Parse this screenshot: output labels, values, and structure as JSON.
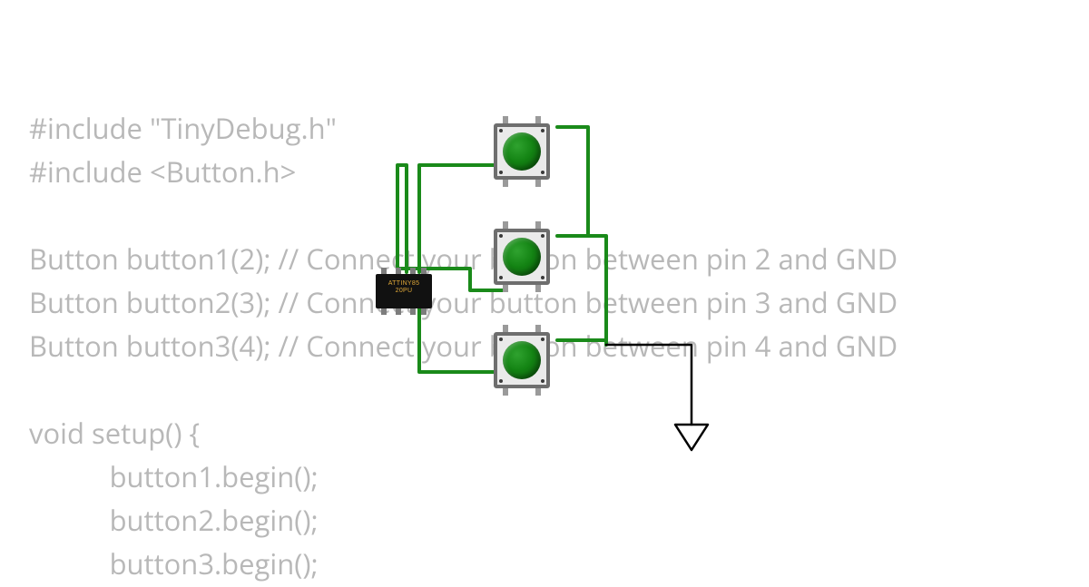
{
  "code": {
    "lines": [
      "#include \"TinyDebug.h\"",
      "#include <Button.h>",
      "",
      "Button button1(2); // Connect your button between pin 2 and GND",
      "Button button2(3); // Connect your button between pin 3 and GND",
      "Button button3(4); // Connect your button between pin 4 and GND",
      "",
      "void setup() {",
      "           button1.begin();",
      "           button2.begin();",
      "           button3.begin();"
    ]
  },
  "chip": {
    "label_line1": "ATTINY85",
    "label_line2": "20PU"
  },
  "components": {
    "buttons": [
      "button1",
      "button2",
      "button3"
    ],
    "ic": "ATtiny85"
  },
  "colors": {
    "wire_signal": "#1a8a1a",
    "wire_gnd": "#000000",
    "code_text": "#b8b8b8",
    "button_cap": "#148414"
  }
}
